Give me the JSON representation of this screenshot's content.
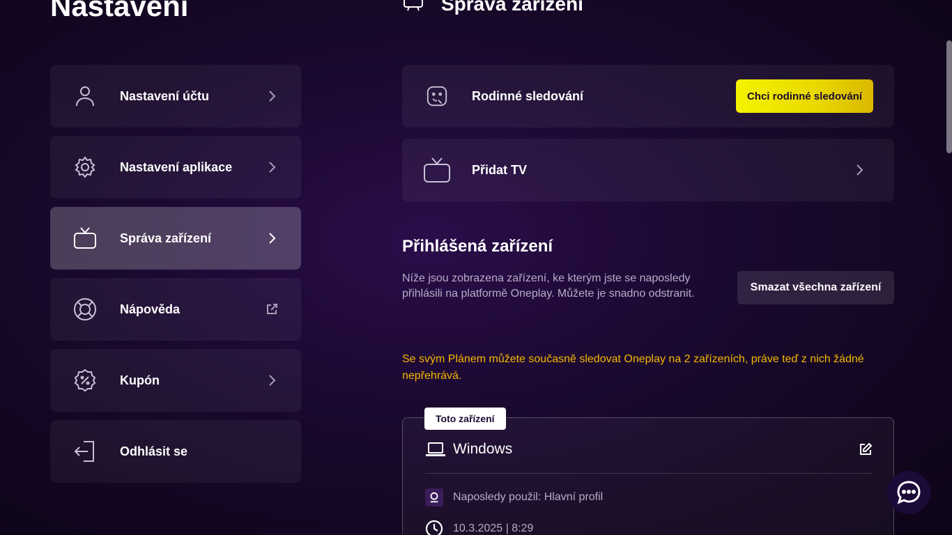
{
  "page": {
    "title": "Nastavení"
  },
  "sidebar": {
    "items": [
      {
        "label": "Nastavení účtu",
        "icon": "user-icon"
      },
      {
        "label": "Nastavení aplikace",
        "icon": "gear-icon"
      },
      {
        "label": "Správa zařízení",
        "icon": "tv-icon",
        "active": true
      },
      {
        "label": "Nápověda",
        "icon": "lifebuoy-icon"
      },
      {
        "label": "Kupón",
        "icon": "coupon-icon"
      },
      {
        "label": "Odhlásit se",
        "icon": "logout-icon"
      }
    ]
  },
  "main": {
    "title": "Správa zařízení",
    "family": {
      "label": "Rodinné sledování",
      "button": "Chci rodinné sledování"
    },
    "add_tv": {
      "label": "Přidat TV"
    },
    "logged_devices": {
      "title": "Přihlášená zařízení",
      "description": "Níže jsou zobrazena zařízení, ke kterým jste se naposledy přihlásili na platformě Oneplay. Můžete je snadno odstranit.",
      "delete_all": "Smazat všechna zařízení",
      "warning": "Se svým Plánem můžete současně sledovat Oneplay na 2 zařízeních, práve teď z nich žádné nepřehrává."
    },
    "device": {
      "badge": "Toto zařízení",
      "name": "Windows",
      "last_used": "Naposledy použil: Hlavní profil",
      "datetime": "10.3.2025 | 8:29"
    }
  },
  "colors": {
    "accent_yellow": "#f5f300",
    "warning": "#f5b800",
    "background": "#1b0930"
  }
}
